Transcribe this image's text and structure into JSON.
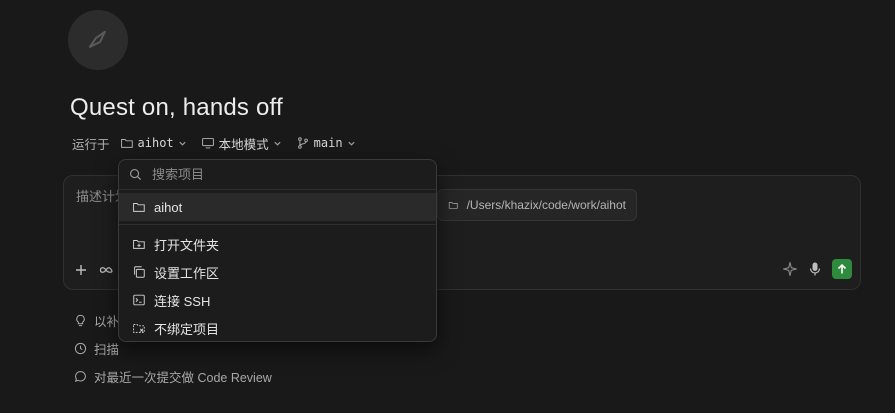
{
  "header": {
    "title": "Quest on, hands off"
  },
  "runbar": {
    "label": "运行于",
    "project": "aihot",
    "mode": "本地模式",
    "branch": "main"
  },
  "composer": {
    "placeholder": "描述计划"
  },
  "path_chip": {
    "path": "/Users/khazix/code/work/aihot"
  },
  "dropdown": {
    "search_placeholder": "搜索项目",
    "selected": "aihot",
    "actions": [
      {
        "label": "打开文件夹",
        "icon": "folder-plus-icon"
      },
      {
        "label": "设置工作区",
        "icon": "copy-icon"
      },
      {
        "label": "连接 SSH",
        "icon": "terminal-icon"
      },
      {
        "label": "不绑定项目",
        "icon": "folder-x-icon"
      }
    ]
  },
  "suggestions": [
    {
      "text": "以补",
      "icon": "lightbulb-icon"
    },
    {
      "text": "扫描",
      "icon": "clock-icon"
    },
    {
      "text": "对最近一次提交做 Code Review",
      "icon": "chat-icon"
    }
  ],
  "colors": {
    "background": "#191919",
    "send_button": "#2f8a3e"
  }
}
